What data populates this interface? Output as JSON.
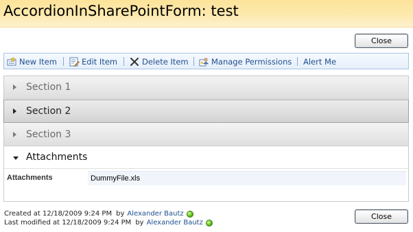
{
  "window": {
    "title": "AccordionInSharePointForm: test"
  },
  "buttons": {
    "close_top": "Close",
    "close_bottom": "Close"
  },
  "toolbar": {
    "items": [
      {
        "label": "New Item",
        "icon": "new-item-icon"
      },
      {
        "label": "Edit Item",
        "icon": "edit-item-icon"
      },
      {
        "label": "Delete Item",
        "icon": "delete-x-icon"
      },
      {
        "label": "Manage Permissions",
        "icon": "manage-permissions-icon"
      },
      {
        "label": "Alert Me",
        "icon": ""
      }
    ]
  },
  "accordion": {
    "sections": [
      {
        "label": "Section 1",
        "state": "collapsed"
      },
      {
        "label": "Section 2",
        "state": "collapsed-hover"
      },
      {
        "label": "Section 3",
        "state": "collapsed"
      },
      {
        "label": "Attachments",
        "state": "expanded"
      }
    ],
    "attachments": {
      "field_label": "Attachments",
      "file": "DummyFile.xls"
    }
  },
  "footer": {
    "created_text": "Created at 12/18/2009 9:24 PM",
    "created_by_label": "by",
    "created_by": "Alexander Bautz",
    "modified_text": "Last modified at 12/18/2009 9:24 PM",
    "modified_by_label": "by",
    "modified_by": "Alexander Bautz",
    "presence_status": "online"
  },
  "colors": {
    "title_bar": "#fce39a",
    "toolbar_link": "#1f4f8f",
    "toolbar_border": "#a9c2e3",
    "presence_online": "#5cc21a"
  }
}
